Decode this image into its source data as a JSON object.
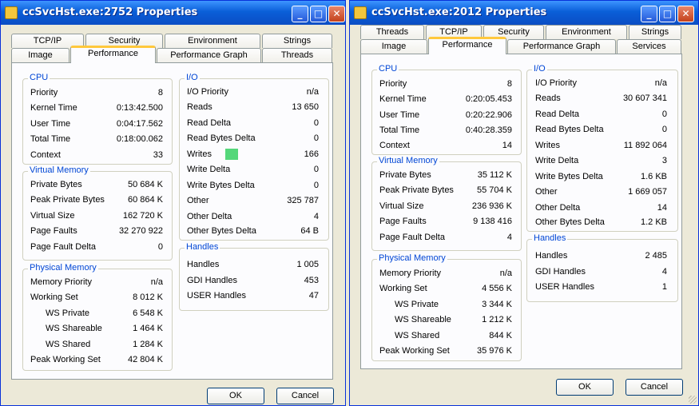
{
  "accent": "#0a5fd8",
  "indicator_color": "#54d77a",
  "windows": [
    {
      "title": "ccSvcHst.exe:2752 Properties",
      "tabs_row1": [
        "TCP/IP",
        "Security",
        "Environment",
        "Strings"
      ],
      "tabs_row2": [
        "Image",
        "Performance",
        "Performance Graph",
        "Threads"
      ],
      "active_tab": "Performance",
      "cpu": {
        "title": "CPU",
        "rows": [
          {
            "label": "Priority",
            "value": "8"
          },
          {
            "label": "Kernel Time",
            "value": "0:13:42.500"
          },
          {
            "label": "User Time",
            "value": "0:04:17.562"
          },
          {
            "label": "Total Time",
            "value": "0:18:00.062"
          },
          {
            "label": "Context",
            "value": "33"
          }
        ]
      },
      "virtual_memory": {
        "title": "Virtual Memory",
        "rows": [
          {
            "label": "Private Bytes",
            "value": "50 684 K"
          },
          {
            "label": "Peak Private Bytes",
            "value": "60 864 K"
          },
          {
            "label": "Virtual Size",
            "value": "162 720 K"
          },
          {
            "label": "Page Faults",
            "value": "32 270 922"
          },
          {
            "label": "Page Fault Delta",
            "value": "0"
          }
        ]
      },
      "physical_memory": {
        "title": "Physical Memory",
        "rows": [
          {
            "label": "Memory Priority",
            "value": "n/a"
          },
          {
            "label": "Working Set",
            "value": "8 012 K"
          },
          {
            "label": "WS Private",
            "value": "6 548 K"
          },
          {
            "label": "WS Shareable",
            "value": "1 464 K"
          },
          {
            "label": "WS Shared",
            "value": "1 284 K"
          },
          {
            "label": "Peak Working Set",
            "value": "42 804 K"
          }
        ]
      },
      "io": {
        "title": "I/O",
        "rows": [
          {
            "label": "I/O Priority",
            "value": "n/a"
          },
          {
            "label": "Reads",
            "value": "13 650"
          },
          {
            "label": "Read Delta",
            "value": "0"
          },
          {
            "label": "Read Bytes Delta",
            "value": "0"
          },
          {
            "label": "Writes",
            "value": "166"
          },
          {
            "label": "Write Delta",
            "value": "0"
          },
          {
            "label": "Write Bytes Delta",
            "value": "0"
          },
          {
            "label": "Other",
            "value": "325 787"
          },
          {
            "label": "Other Delta",
            "value": "4"
          },
          {
            "label": "Other Bytes Delta",
            "value": "64 B"
          }
        ]
      },
      "handles": {
        "title": "Handles",
        "rows": [
          {
            "label": "Handles",
            "value": "1 005"
          },
          {
            "label": "GDI Handles",
            "value": "453"
          },
          {
            "label": "USER Handles",
            "value": "47"
          }
        ]
      },
      "ok_label": "OK",
      "cancel_label": "Cancel"
    },
    {
      "title": "ccSvcHst.exe:2012 Properties",
      "tabs_row1": [
        "Threads",
        "TCP/IP",
        "Security",
        "Environment",
        "Strings"
      ],
      "tabs_row2": [
        "Image",
        "Performance",
        "Performance Graph",
        "Services"
      ],
      "active_tab": "Performance",
      "cpu": {
        "title": "CPU",
        "rows": [
          {
            "label": "Priority",
            "value": "8"
          },
          {
            "label": "Kernel Time",
            "value": "0:20:05.453"
          },
          {
            "label": "User Time",
            "value": "0:20:22.906"
          },
          {
            "label": "Total Time",
            "value": "0:40:28.359"
          },
          {
            "label": "Context",
            "value": "14"
          }
        ]
      },
      "virtual_memory": {
        "title": "Virtual Memory",
        "rows": [
          {
            "label": "Private Bytes",
            "value": "35 112 K"
          },
          {
            "label": "Peak Private Bytes",
            "value": "55 704 K"
          },
          {
            "label": "Virtual Size",
            "value": "236 936 K"
          },
          {
            "label": "Page Faults",
            "value": "9 138 416"
          },
          {
            "label": "Page Fault Delta",
            "value": "4"
          }
        ]
      },
      "physical_memory": {
        "title": "Physical Memory",
        "rows": [
          {
            "label": "Memory Priority",
            "value": "n/a"
          },
          {
            "label": "Working Set",
            "value": "4 556 K"
          },
          {
            "label": "WS Private",
            "value": "3 344 K"
          },
          {
            "label": "WS Shareable",
            "value": "1 212 K"
          },
          {
            "label": "WS Shared",
            "value": "844 K"
          },
          {
            "label": "Peak Working Set",
            "value": "35 976 K"
          }
        ]
      },
      "io": {
        "title": "I/O",
        "rows": [
          {
            "label": "I/O Priority",
            "value": "n/a"
          },
          {
            "label": "Reads",
            "value": "30 607 341"
          },
          {
            "label": "Read Delta",
            "value": "0"
          },
          {
            "label": "Read Bytes Delta",
            "value": "0"
          },
          {
            "label": "Writes",
            "value": "11 892 064"
          },
          {
            "label": "Write Delta",
            "value": "3"
          },
          {
            "label": "Write Bytes Delta",
            "value": "1.6  KB"
          },
          {
            "label": "Other",
            "value": "1 669 057"
          },
          {
            "label": "Other Delta",
            "value": "14"
          },
          {
            "label": "Other Bytes Delta",
            "value": "1.2  KB"
          }
        ]
      },
      "handles": {
        "title": "Handles",
        "rows": [
          {
            "label": "Handles",
            "value": "2 485"
          },
          {
            "label": "GDI Handles",
            "value": "4"
          },
          {
            "label": "USER Handles",
            "value": "1"
          }
        ]
      },
      "ok_label": "OK",
      "cancel_label": "Cancel"
    }
  ]
}
